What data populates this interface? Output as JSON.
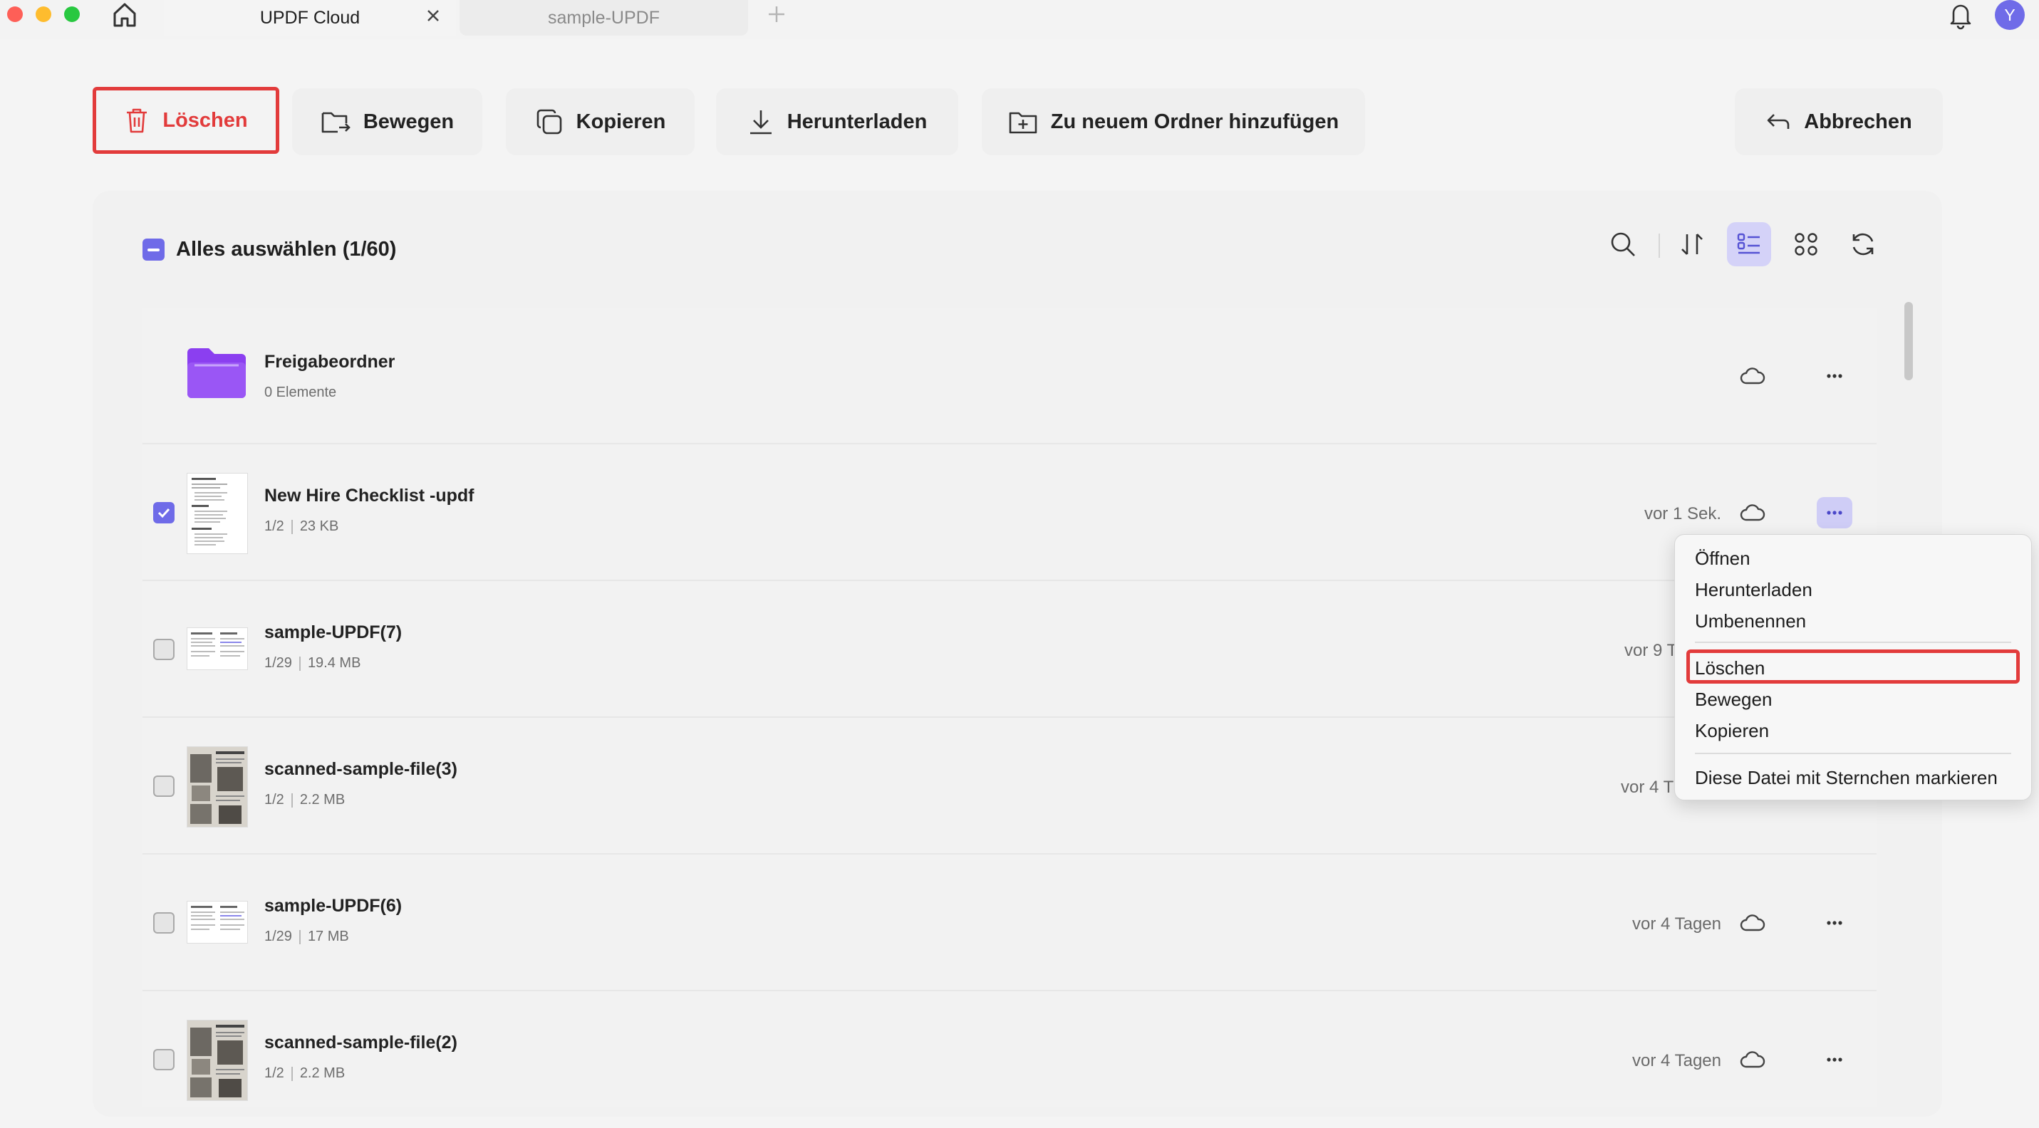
{
  "titlebar": {
    "tabs": [
      {
        "label": "UPDF Cloud",
        "active": true
      },
      {
        "label": "sample-UPDF",
        "active": false
      }
    ],
    "avatar_initial": "Y"
  },
  "toolbar": {
    "delete_label": "Löschen",
    "move_label": "Bewegen",
    "copy_label": "Kopieren",
    "download_label": "Herunterladen",
    "add_folder_label": "Zu neuem Ordner hinzufügen",
    "cancel_label": "Abbrechen"
  },
  "list_header": {
    "select_all_label": "Alles auswählen (1/60)"
  },
  "files": [
    {
      "name": "Freigabeordner",
      "pages": "0 Elemente",
      "size": "",
      "time": "",
      "type": "folder",
      "checked": false
    },
    {
      "name": "New Hire Checklist -updf",
      "pages": "1/2",
      "size": "23 KB",
      "time": "vor 1 Sek.",
      "type": "doc",
      "checked": true
    },
    {
      "name": "sample-UPDF(7)",
      "pages": "1/29",
      "size": "19.4 MB",
      "time": "vor 9 T",
      "type": "wide",
      "checked": false
    },
    {
      "name": "scanned-sample-file(3)",
      "pages": "1/2",
      "size": "2.2 MB",
      "time": "vor 4 T",
      "type": "scan",
      "checked": false
    },
    {
      "name": "sample-UPDF(6)",
      "pages": "1/29",
      "size": "17 MB",
      "time": "vor 4 Tagen",
      "type": "wide",
      "checked": false
    },
    {
      "name": "scanned-sample-file(2)",
      "pages": "1/2",
      "size": "2.2 MB",
      "time": "vor 4 Tagen",
      "type": "scan",
      "checked": false
    }
  ],
  "context_menu": {
    "items": [
      "Öffnen",
      "Herunterladen",
      "Umbenennen",
      "Löschen",
      "Bewegen",
      "Kopieren",
      "Diese Datei mit Sternchen markieren"
    ]
  },
  "colors": {
    "accent": "#6f6be8",
    "danger": "#e23b3b",
    "folder": "#8b3ff0"
  }
}
